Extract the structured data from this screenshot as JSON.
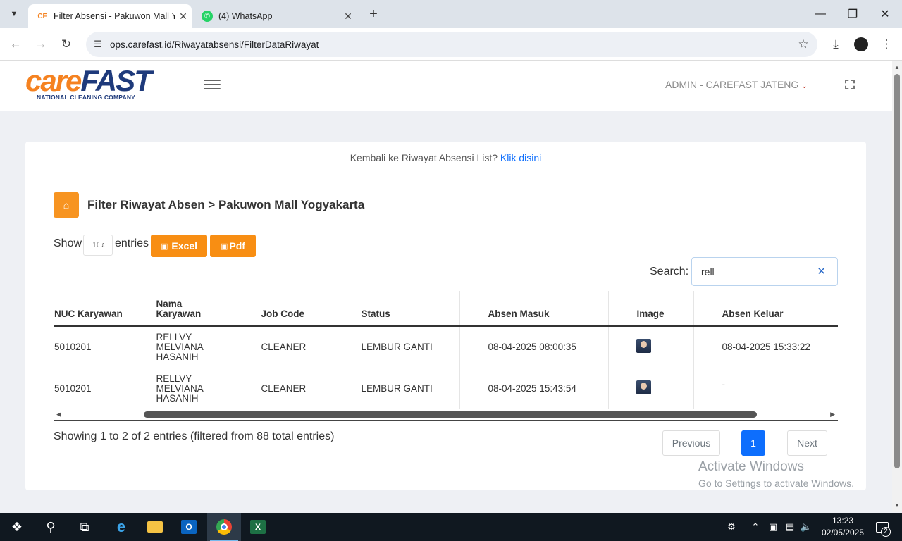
{
  "browser": {
    "tabs": [
      {
        "title": "Filter Absensi - Pakuwon Mall Y",
        "active": true
      },
      {
        "title": "(4) WhatsApp",
        "active": false
      }
    ],
    "url": "ops.carefast.id/Riwayatabsensi/FilterDataRiwayat"
  },
  "header": {
    "logo_care": "care",
    "logo_fast": "FAST",
    "logo_tagline": "NATIONAL CLEANING COMPANY",
    "user": "ADMIN - CAREFAST JATENG"
  },
  "card": {
    "back_text": "Kembali ke Riwayat Absensi List?",
    "back_link": "Klik disini",
    "title": "Filter Riwayat Absen > Pakuwon Mall Yogyakarta",
    "show_label": "Show",
    "entries_label": "entries",
    "page_length": "10",
    "excel_label": "Excel",
    "pdf_label": "Pdf",
    "search_label": "Search:",
    "search_value": "rell"
  },
  "table": {
    "columns": [
      "NUC Karyawan",
      "Nama Karyawan",
      "Job Code",
      "Status",
      "Absen Masuk",
      "Image",
      "Absen Keluar"
    ],
    "rows": [
      {
        "nuc": "5010201",
        "nama": "RELLVY MELVIANA HASANIH",
        "job": "CLEANER",
        "status": "LEMBUR GANTI",
        "masuk": "08-04-2025 08:00:35",
        "keluar": "08-04-2025 15:33:22"
      },
      {
        "nuc": "5010201",
        "nama": "RELLVY MELVIANA HASANIH",
        "job": "CLEANER",
        "status": "LEMBUR GANTI",
        "masuk": "08-04-2025 15:43:54",
        "keluar": "-"
      }
    ]
  },
  "footer": {
    "info": "Showing 1 to 2 of 2 entries (filtered from 88 total entries)",
    "prev": "Previous",
    "page": "1",
    "next": "Next"
  },
  "watermark": {
    "line1": "Activate Windows",
    "line2": "Go to Settings to activate Windows."
  },
  "taskbar": {
    "time": "13:23",
    "date": "02/05/2025",
    "notifications": "2"
  }
}
